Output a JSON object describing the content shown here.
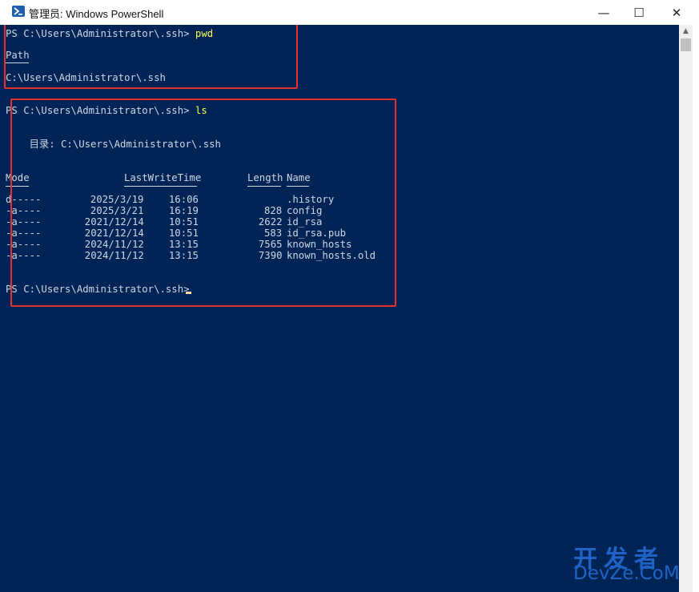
{
  "window": {
    "title": "管理员: Windows PowerShell",
    "minimize_glyph": "—",
    "maximize_glyph": "☐",
    "close_glyph": "✕"
  },
  "console": {
    "prompt": "PS C:\\Users\\Administrator\\.ssh> ",
    "cmd1": "pwd",
    "path_header": "Path",
    "path_divider": "----",
    "path_value": "C:\\Users\\Administrator\\.ssh",
    "cmd2": "ls",
    "dir_label": "    目录: C:\\Users\\Administrator\\.ssh",
    "columns": {
      "mode": "Mode",
      "lastwrite": "LastWriteTime",
      "length": "Length",
      "name": "Name"
    },
    "files": [
      {
        "mode": "d-----",
        "date": "2025/3/19",
        "time": "16:06",
        "length": "",
        "name": ".history"
      },
      {
        "mode": "-a----",
        "date": "2025/3/21",
        "time": "16:19",
        "length": "828",
        "name": "config"
      },
      {
        "mode": "-a----",
        "date": "2021/12/14",
        "time": "10:51",
        "length": "2622",
        "name": "id_rsa"
      },
      {
        "mode": "-a----",
        "date": "2021/12/14",
        "time": "10:51",
        "length": "583",
        "name": "id_rsa.pub"
      },
      {
        "mode": "-a----",
        "date": "2024/11/12",
        "time": "13:15",
        "length": "7565",
        "name": "known_hosts"
      },
      {
        "mode": "-a----",
        "date": "2024/11/12",
        "time": "13:15",
        "length": "7390",
        "name": "known_hosts.old"
      }
    ]
  },
  "watermark": {
    "cn": "开发者",
    "en": "DevZe.CoM"
  },
  "colors": {
    "console_bg": "#012456",
    "command": "#ffff55",
    "highlight_box": "#e53030"
  }
}
